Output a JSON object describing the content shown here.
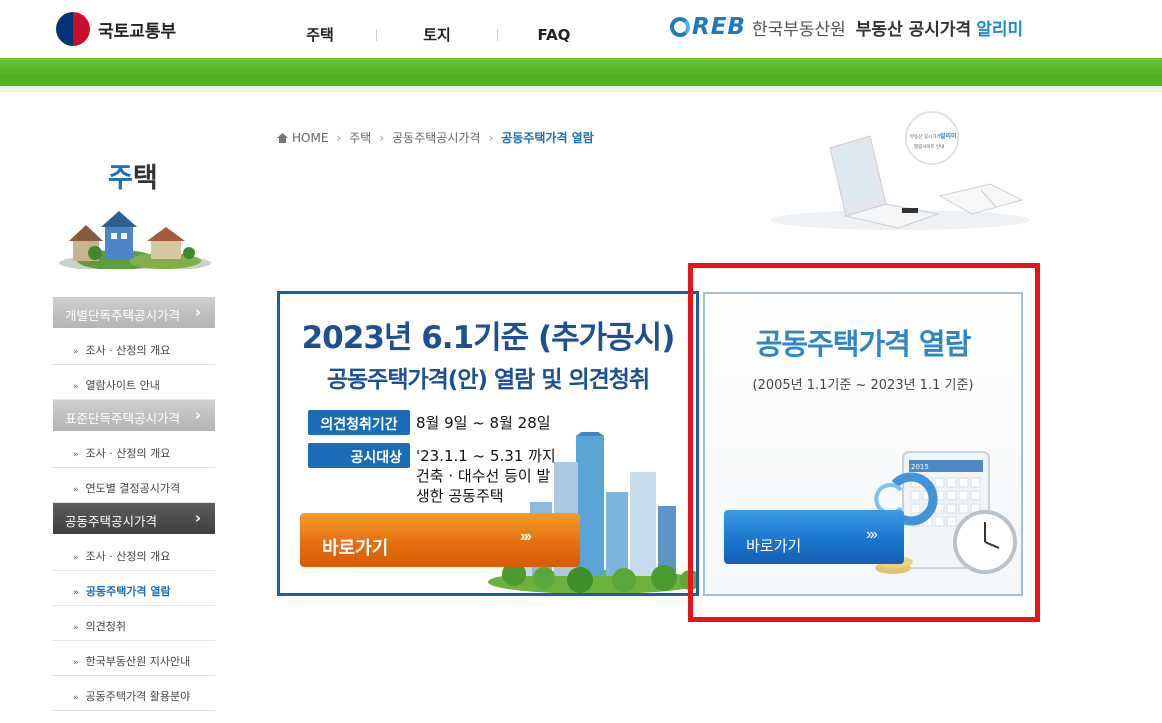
{
  "header": {
    "ministry_name": "국토교통부",
    "nav": [
      "주택",
      "토지",
      "FAQ"
    ],
    "reb_letters": "REB",
    "reb_name": "한국부동산원",
    "service_title": "부동산 공시가격",
    "service_accent": "알리미"
  },
  "sidebar": {
    "title_first": "주",
    "title_rest": "택",
    "sections": [
      {
        "label": "개별단독주택공시가격",
        "arrow": "›"
      },
      {
        "label": "표준단독주택공시가격",
        "arrow": "›"
      },
      {
        "label": "공동주택공시가격",
        "arrow": "›"
      }
    ],
    "items": [
      {
        "bullet": "»",
        "label": "조사 · 산정의 개요"
      },
      {
        "bullet": "»",
        "label": "열람사이트 안내"
      },
      {
        "bullet": "»",
        "label": "조사 · 산정의 개요"
      },
      {
        "bullet": "»",
        "label": "연도별 결정공시가격"
      },
      {
        "bullet": "»",
        "label": "조사 · 산정의 개요"
      },
      {
        "bullet": "»",
        "label": "공동주택가격 열람"
      },
      {
        "bullet": "»",
        "label": "의견청취"
      },
      {
        "bullet": "»",
        "label": "한국부동산원 지사안내"
      },
      {
        "bullet": "»",
        "label": "공동주택가격 활용분야"
      }
    ]
  },
  "breadcrumb": {
    "home": "HOME",
    "sep": "›",
    "items": [
      "주택",
      "공동주택공시가격",
      "공동주택가격 열람"
    ]
  },
  "laptop_art": {
    "screen_line1": "부동산 공시가격",
    "screen_accent": "알리미",
    "screen_line2": "열람사이트 안내"
  },
  "left_card": {
    "title": "2023년 6.1기준 (추가공시)",
    "subtitle": "공동주택가격(안) 열람 및 의견청취",
    "tag1_label": "의견청취기간",
    "tag1_value": "8월 9일 ~ 8월 28일",
    "tag2_label": "공시대상",
    "tag2_value": "'23.1.1 ~ 5.31 까지 건축 · 대수선 등이 발생한 공동주택",
    "button_label": "바로가기",
    "button_chevron": "›››"
  },
  "right_card": {
    "title": "공동주택가격 열람",
    "subtitle": "(2005년 1.1기준 ~ 2023년 1.1 기준)",
    "button_label": "바로가기",
    "button_chevron": "›››",
    "calendar_year": "2015"
  },
  "colors": {
    "brand_blue": "#1d4f93",
    "accent_blue": "#2e86c5",
    "green_band": "#4fae1d",
    "highlight_red": "#e8121b",
    "orange_button": "#e66f0f"
  }
}
